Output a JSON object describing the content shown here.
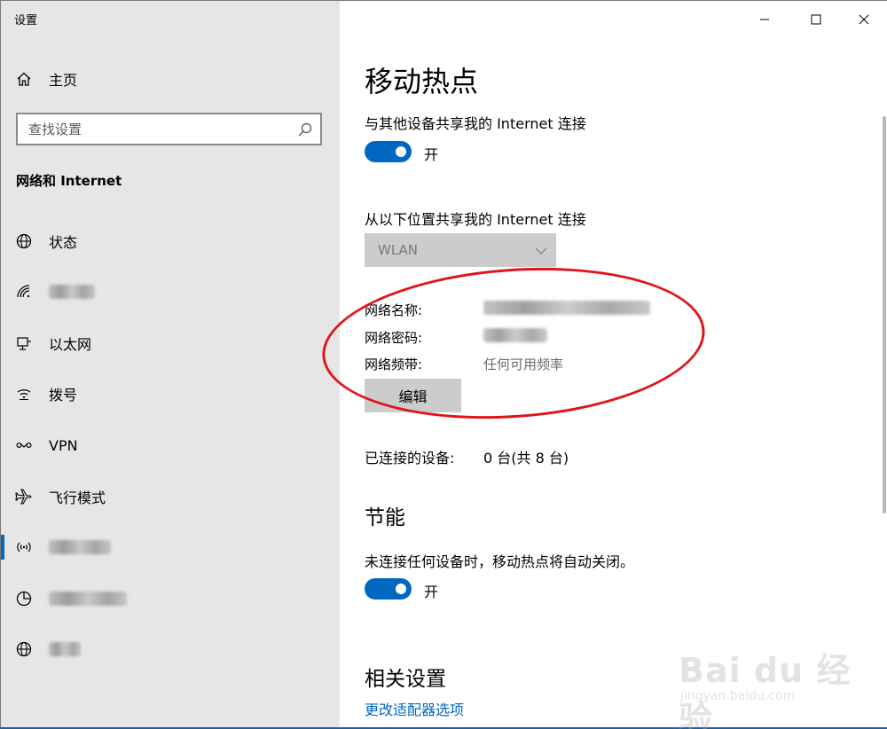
{
  "window": {
    "title": "设置",
    "controls": [
      "minimize-icon",
      "maximize-icon",
      "close-icon"
    ]
  },
  "sidebar": {
    "home": {
      "label": "主页",
      "icon": "home-icon"
    },
    "search": {
      "placeholder": "查找设置",
      "icon": "search-icon"
    },
    "section": "网络和 Internet",
    "items": [
      {
        "label": "状态",
        "icon": "globe-status-icon",
        "blurred": false
      },
      {
        "label": "",
        "icon": "wifi-icon",
        "blurred": true
      },
      {
        "label": "以太网",
        "icon": "ethernet-icon",
        "blurred": false
      },
      {
        "label": "拨号",
        "icon": "dialup-icon",
        "blurred": false
      },
      {
        "label": "VPN",
        "icon": "vpn-icon",
        "blurred": false
      },
      {
        "label": "飞行模式",
        "icon": "airplane-icon",
        "blurred": false
      },
      {
        "label": "",
        "icon": "hotspot-icon",
        "blurred": true,
        "active": true
      },
      {
        "label": "",
        "icon": "data-usage-icon",
        "blurred": true
      },
      {
        "label": "",
        "icon": "proxy-globe-icon",
        "blurred": true
      }
    ],
    "accent": "#0067c0"
  },
  "main": {
    "title": "移动热点",
    "share_label": "与其他设备共享我的 Internet 连接",
    "share_toggle": {
      "state": "开",
      "on": true
    },
    "source_label": "从以下位置共享我的 Internet 连接",
    "source_dropdown": {
      "value": "WLAN"
    },
    "network_name_label": "网络名称:",
    "network_password_label": "网络密码:",
    "network_band_label": "网络频带:",
    "network_band_value": "任何可用频率",
    "edit_button": "编辑",
    "connected_label": "已连接的设备:",
    "connected_value": "0 台(共 8 台)",
    "power_section": "节能",
    "power_label": "未连接任何设备时，移动热点将自动关闭。",
    "power_toggle": {
      "state": "开",
      "on": true
    },
    "related_section": "相关设置",
    "related_link": "更改适配器选项"
  },
  "watermark": {
    "main": "Bai du 经验",
    "sub": "jingyan.baidu.com"
  },
  "colors": {
    "toggle_on": "#0067c0",
    "annotation": "#e0151a",
    "sidebar_bg": "#e6e6e6"
  }
}
